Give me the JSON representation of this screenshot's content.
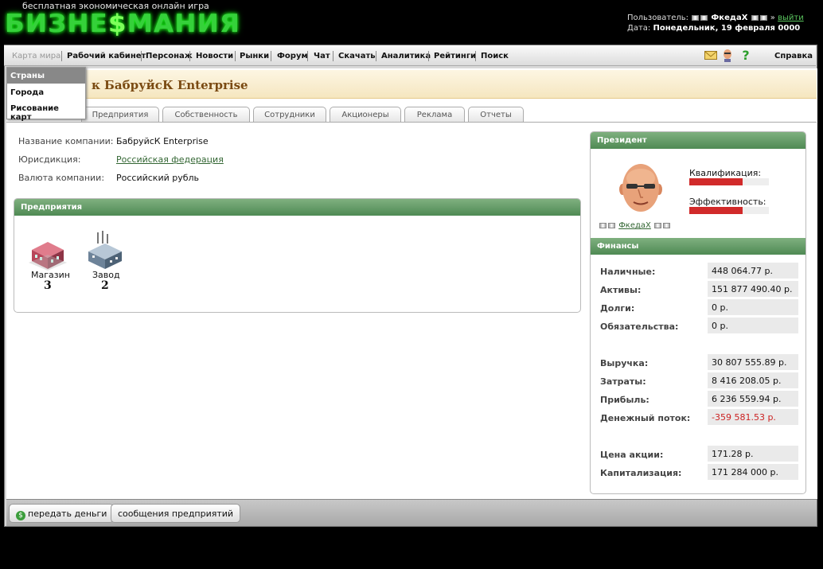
{
  "header": {
    "tagline": "бесплатная экономическая онлайн игра",
    "logo_part1": "БИЗНЕ",
    "logo_dollar": "$",
    "logo_part2": "МАНИЯ",
    "user_label": "Пользователь:",
    "user_name": "ФкедаХ",
    "logout": "выйти",
    "date_label": "Дата:",
    "date_value": "Понедельник, 19 февраля 0000"
  },
  "menu": {
    "items": [
      "Карта мира",
      "Рабочий кабинет",
      "Персонаж",
      "Новости",
      "Рынки",
      "Форум",
      "Чат",
      "Скачать",
      "Аналитика",
      "Рейтинги",
      "Поиск"
    ],
    "help": "Справка",
    "dropdown": [
      "Страны",
      "Города",
      "Рисование карт"
    ]
  },
  "company": {
    "title": "к БабруйсК Enterprise",
    "tabs": [
      "Предприятия",
      "Собственность",
      "Сотрудники",
      "Акционеры",
      "Реклама",
      "Отчеты"
    ],
    "fields": [
      {
        "label": "Название компании:",
        "value": "БабруйсК Enterprise"
      },
      {
        "label": "Юрисдикция:",
        "value": "Российская федерация"
      },
      {
        "label": "Валюта компании:",
        "value": "Российский рубль"
      }
    ]
  },
  "enterprises": {
    "title": "Предприятия",
    "items": [
      {
        "name": "Магазин",
        "count": "3"
      },
      {
        "name": "Завод",
        "count": "2"
      }
    ]
  },
  "president": {
    "title": "Президент",
    "name": "ФкедаХ",
    "qualification_label": "Квалификация:",
    "qualification_level": 0.67,
    "efficiency_label": "Эффективность:",
    "efficiency_level": 0.67
  },
  "finance": {
    "title": "Финансы",
    "rows": [
      {
        "label": "Наличные:",
        "value": "448 064.77 р."
      },
      {
        "label": "Активы:",
        "value": "151 877 490.40 р."
      },
      {
        "label": "Долги:",
        "value": "0 р."
      },
      {
        "label": "Обязательства:",
        "value": "0 р."
      },
      {
        "label": "Выручка:",
        "value": "30 807 555.89 р."
      },
      {
        "label": "Затраты:",
        "value": "8 416 208.05 р."
      },
      {
        "label": "Прибыль:",
        "value": "6 236 559.94 р."
      },
      {
        "label": "Денежный поток:",
        "value": "-359 581.53 р."
      },
      {
        "label": "Цена акции:",
        "value": "171.28 р."
      },
      {
        "label": "Капитализация:",
        "value": "171 284 000 р."
      }
    ],
    "negative_color": "#cc2222"
  },
  "actions": {
    "send_money": "передать деньги",
    "messages": "сообщения предприятий"
  }
}
